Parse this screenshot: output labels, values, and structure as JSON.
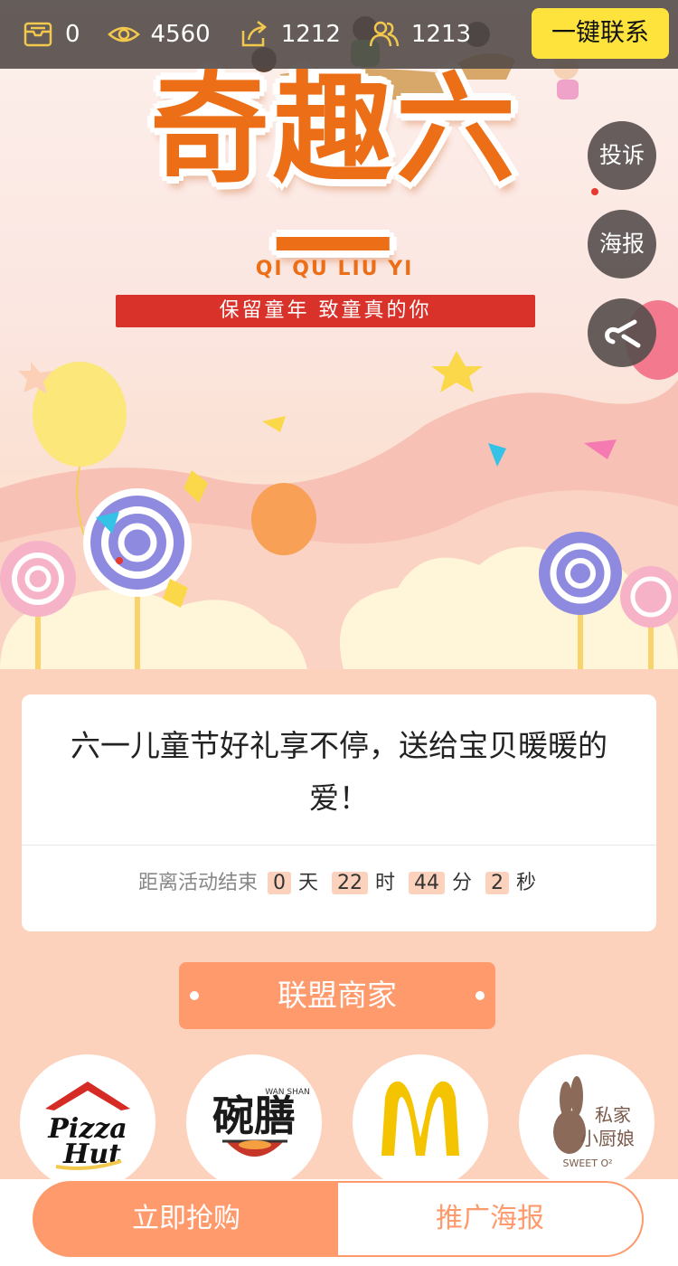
{
  "stats": {
    "stock": "0",
    "views": "4560",
    "shares": "1212",
    "participants": "1213"
  },
  "contact_button": "一键联系",
  "side_buttons": {
    "complain": "投诉",
    "poster": "海报"
  },
  "banner": {
    "title": "奇趣六一",
    "pinyin": "QI QU LIU YI",
    "slogan": "保留童年 致童真的你"
  },
  "card": {
    "title": "六一儿童节好礼享不停，送给宝贝暖暖的爱！",
    "countdown_label": "距离活动结束",
    "days": "0",
    "day_unit": "天",
    "hours": "22",
    "hour_unit": "时",
    "minutes": "44",
    "minute_unit": "分",
    "seconds": "2",
    "second_unit": "秒"
  },
  "section": {
    "merchants_title": "联盟商家"
  },
  "merchants": [
    {
      "name": "Pizza Hut",
      "line1": "Pizza",
      "line2": "Hut"
    },
    {
      "name": "碗膳",
      "mark": "碗膳",
      "sub": "WAN SHAN"
    },
    {
      "name": "McDonald's"
    },
    {
      "name": "私家小厨娘",
      "line1": "私家",
      "line2": "小厨娘",
      "sub": "SWEET O²"
    }
  ],
  "bottom": {
    "buy_label": "立即抢购",
    "poster_label": "推广海报"
  },
  "colors": {
    "accent": "#fe9a6c",
    "page_bg": "#fcd2bd",
    "contact_btn": "#fde33b",
    "title_orange": "#ec6e16",
    "ribbon_red": "#d9322a"
  }
}
